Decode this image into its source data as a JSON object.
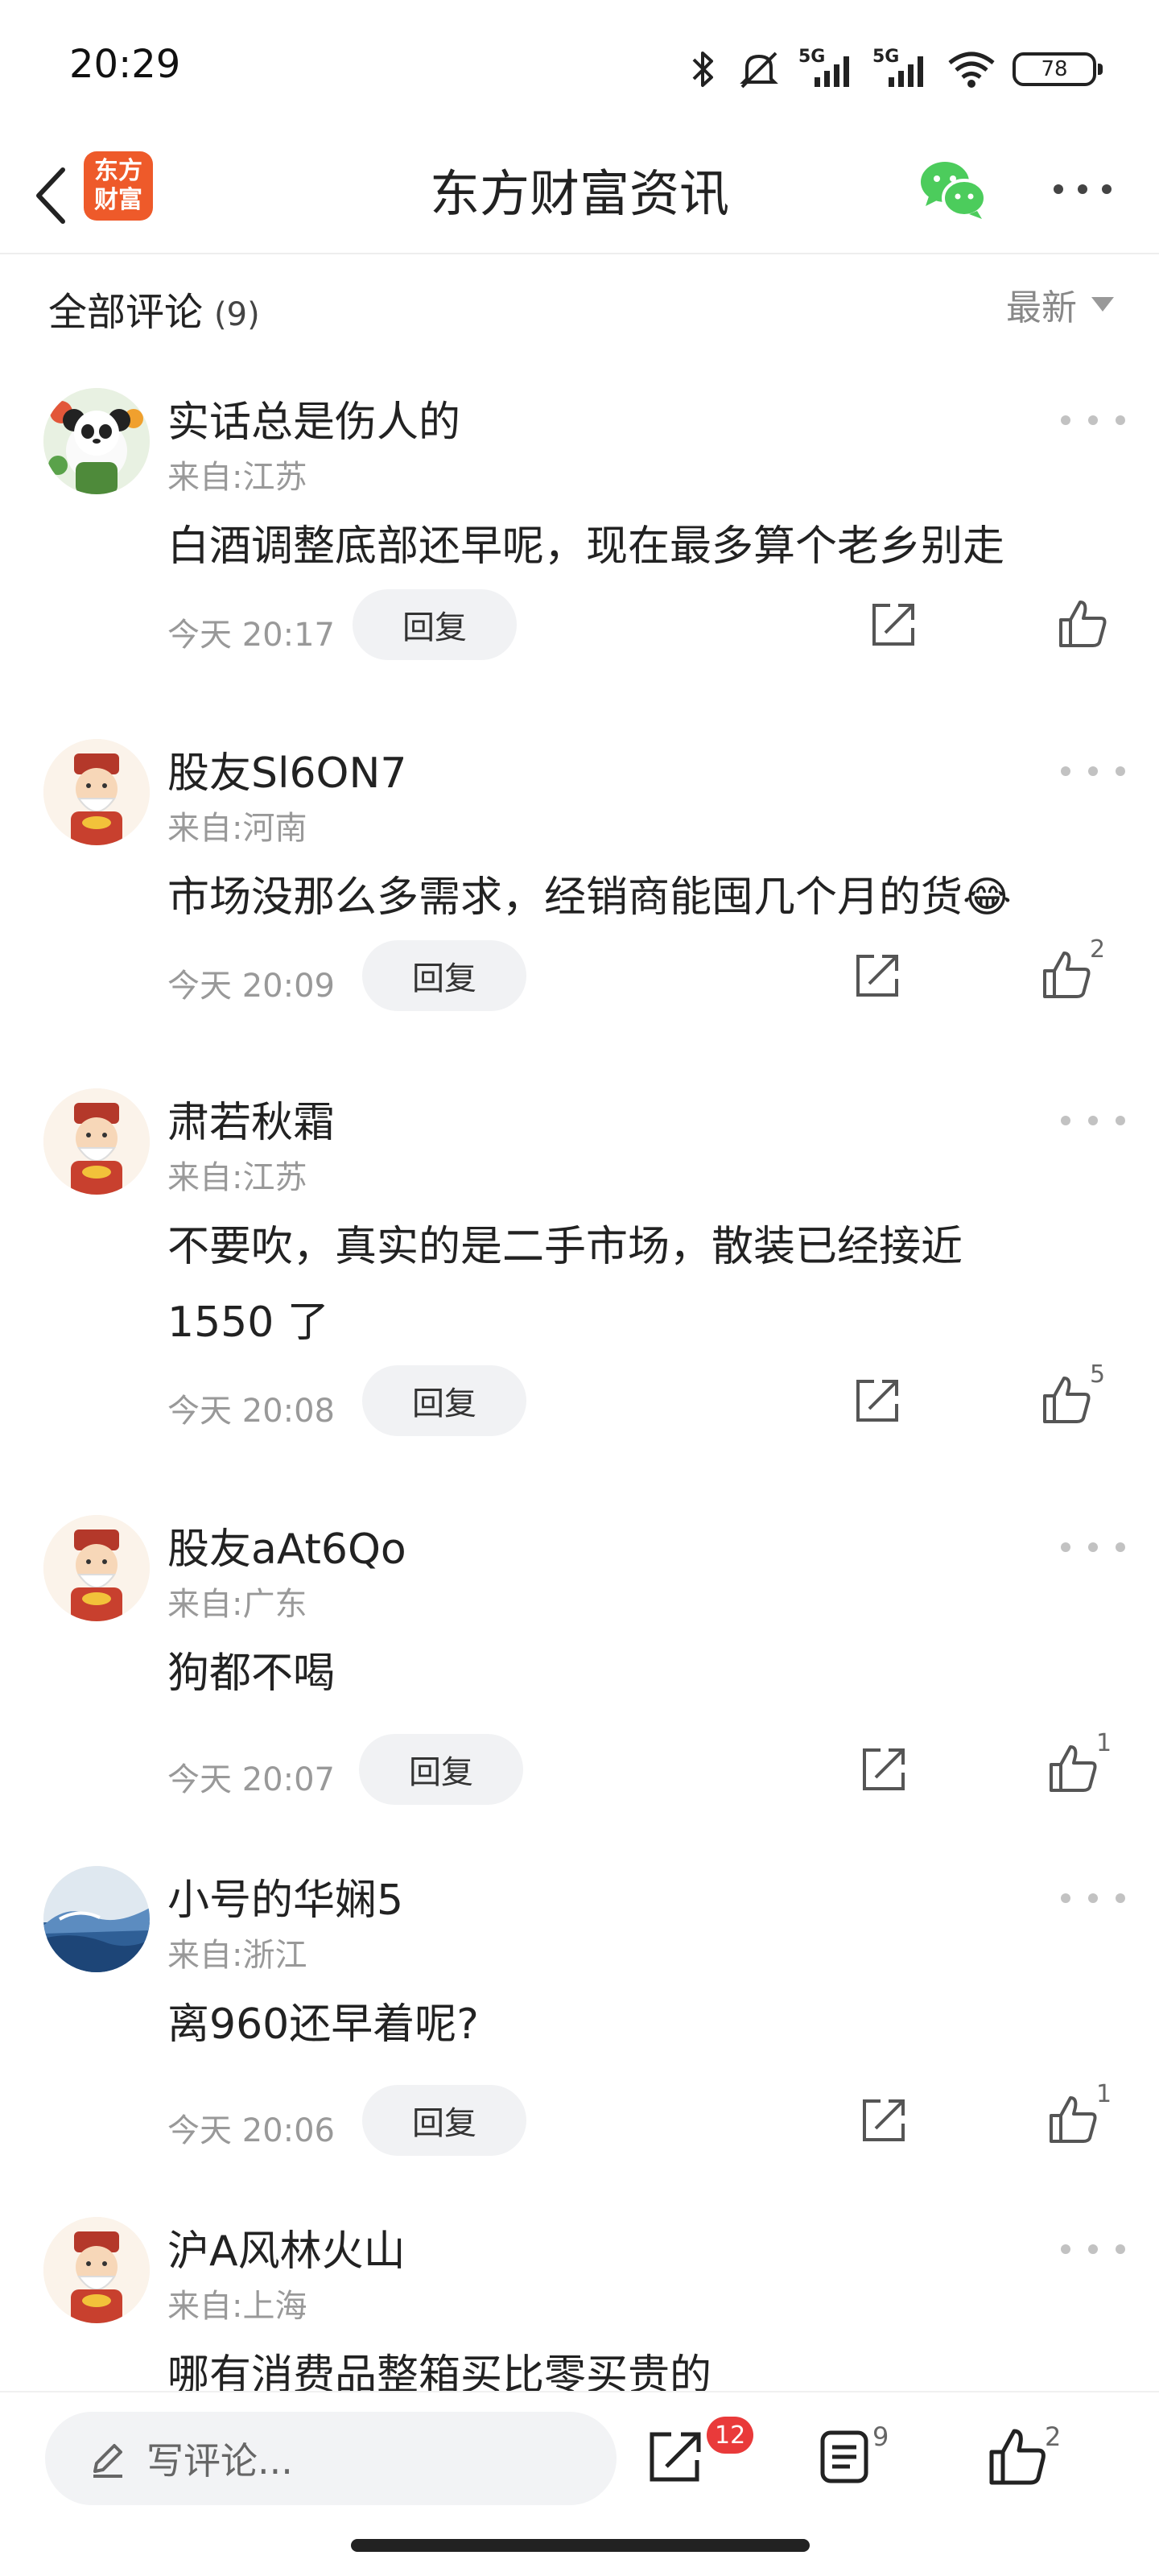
{
  "status_bar": {
    "time": "20:29",
    "battery": "78",
    "network_labels": [
      "5G",
      "5G"
    ],
    "icons": [
      "bluetooth-icon",
      "mute-icon",
      "signal-icon",
      "signal-icon",
      "wifi-icon",
      "battery-icon"
    ]
  },
  "title_bar": {
    "logo_line1": "东方",
    "logo_line2": "财富",
    "title": "东方财富资讯",
    "icons": [
      "back-arrow-icon",
      "wechat-icon",
      "more-icon"
    ],
    "colors": {
      "logo": "#ee5a2a",
      "wechat": "#4ccc5c"
    }
  },
  "comments_header": {
    "label": "全部评论",
    "count": "(9)",
    "sort_label": "最新"
  },
  "comments": [
    {
      "user": "实话总是伤人的",
      "location": "来自:江苏",
      "text": "白酒调整底部还早呢，现在最多算个老乡别走",
      "time": "今天 20:17",
      "reply": "回复",
      "likes": ""
    },
    {
      "user": "股友Sl6ON7",
      "location": "来自:河南",
      "text": "市场没那么多需求，经销商能囤几个月的货😂",
      "time": "今天 20:09",
      "reply": "回复",
      "likes": "2"
    },
    {
      "user": "肃若秋霜",
      "location": "来自:江苏",
      "text": "不要吹，真实的是二手市场，散装已经接近1550 了",
      "time": "今天 20:08",
      "reply": "回复",
      "likes": "5"
    },
    {
      "user": "股友aAt6Qo",
      "location": "来自:广东",
      "text": "狗都不喝",
      "time": "今天 20:07",
      "reply": "回复",
      "likes": "1"
    },
    {
      "user": "小号的华娴5",
      "location": "来自:浙江",
      "text": "离960还早着呢?",
      "time": "今天 20:06",
      "reply": "回复",
      "likes": "1"
    },
    {
      "user": "沪A风林火山",
      "location": "来自:上海",
      "text": "哪有消费品整箱买比零买贵的",
      "time": "",
      "reply": "",
      "likes": ""
    }
  ],
  "bottom_bar": {
    "placeholder": "写评论...",
    "share_badge": "12",
    "comment_count": "9",
    "like_count": "2",
    "icons": [
      "pencil-icon",
      "share-icon",
      "comments-icon",
      "thumbs-up-icon"
    ]
  }
}
